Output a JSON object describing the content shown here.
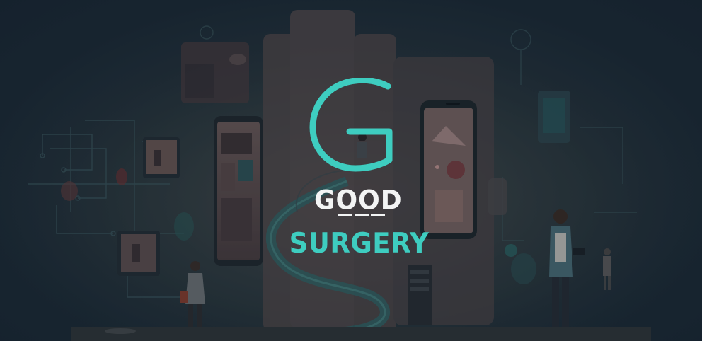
{
  "brand": {
    "word_top": "GOOD",
    "word_bottom": "SURGERY",
    "mark_letter": "G",
    "colors": {
      "accent": "#3ecdc0",
      "text_light": "#f3f4f4",
      "background": "#1b2a35"
    }
  },
  "icons": {
    "logo": "g-monogram-icon"
  }
}
